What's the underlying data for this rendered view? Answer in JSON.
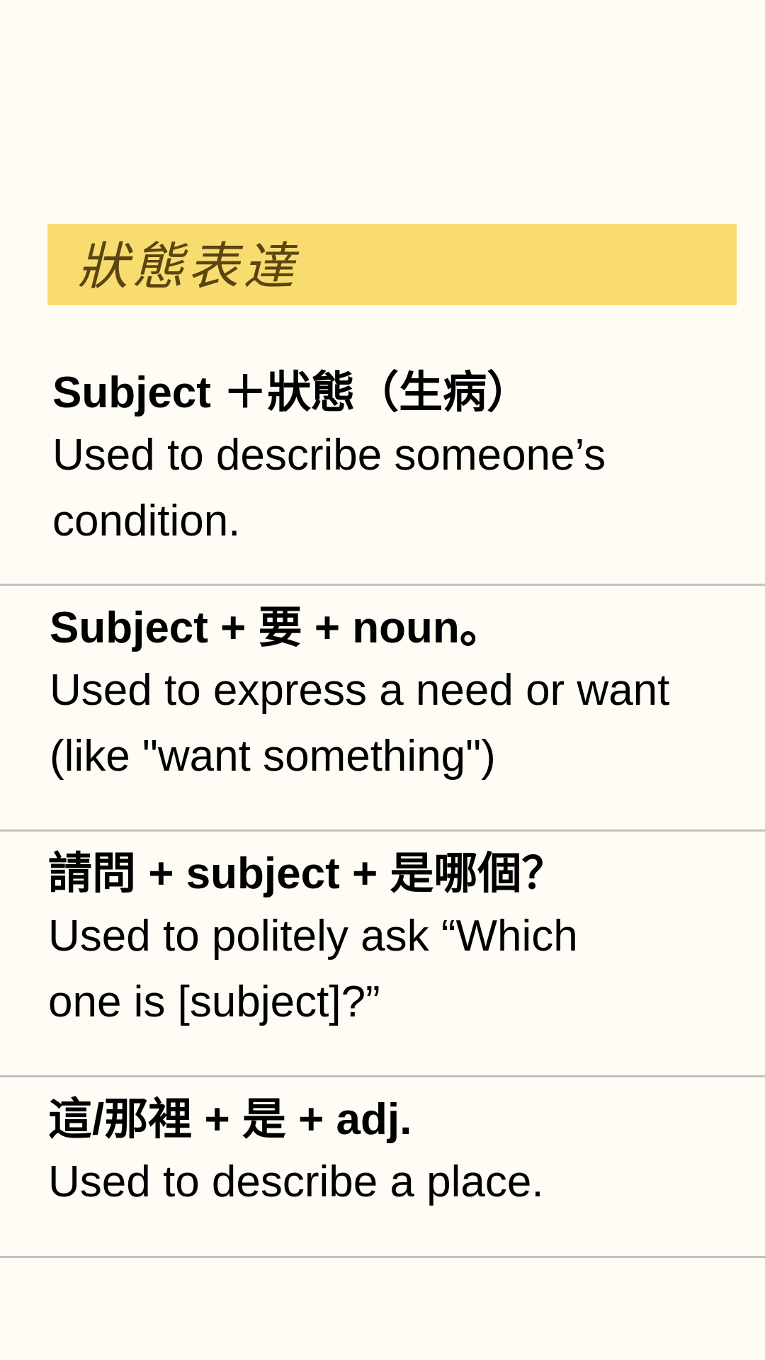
{
  "header": {
    "title": "狀態表達"
  },
  "grammar_points": [
    {
      "pattern": "Subject ＋狀態（生病）",
      "description": "Used to describe someone’s condition."
    },
    {
      "pattern": "Subject + 要 + noun。",
      "description": "Used to express a need or want (like \"want something\")"
    },
    {
      "pattern": "請問 + subject + 是哪個？",
      "description": "Used to politely ask “Which one is [subject]?”"
    },
    {
      "pattern": "這/那裡 + 是 + adj.",
      "description": "Used to describe a place."
    }
  ],
  "colors": {
    "background": "#fefcf4",
    "header_band": "#f9dc6f",
    "header_text": "#5a4510",
    "divider": "#c2c2c2"
  }
}
